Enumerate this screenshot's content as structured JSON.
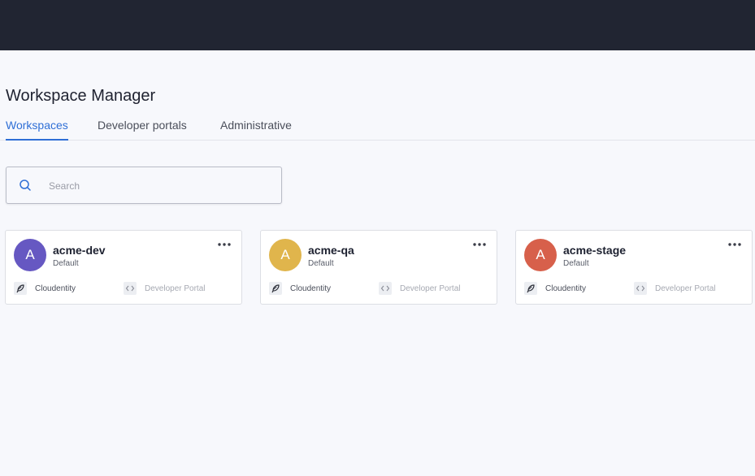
{
  "header": {
    "title": "Workspace Manager"
  },
  "tabs": [
    {
      "label": "Workspaces",
      "active": true
    },
    {
      "label": "Developer portals",
      "active": false
    },
    {
      "label": "Administrative",
      "active": false
    }
  ],
  "search": {
    "placeholder": "Search",
    "value": "",
    "icon": "search-icon"
  },
  "workspaces": [
    {
      "initial": "A",
      "name": "acme-dev",
      "type": "Default",
      "avatar_color": "#6658c2",
      "link_primary": "Cloudentity",
      "link_secondary": "Developer Portal"
    },
    {
      "initial": "A",
      "name": "acme-qa",
      "type": "Default",
      "avatar_color": "#e0b54c",
      "link_primary": "Cloudentity",
      "link_secondary": "Developer Portal"
    },
    {
      "initial": "A",
      "name": "acme-stage",
      "type": "Default",
      "avatar_color": "#d7604b",
      "link_primary": "Cloudentity",
      "link_secondary": "Developer Portal"
    }
  ],
  "colors": {
    "topbar": "#212532",
    "accent": "#2f6fd6",
    "background": "#f7f8fc"
  }
}
